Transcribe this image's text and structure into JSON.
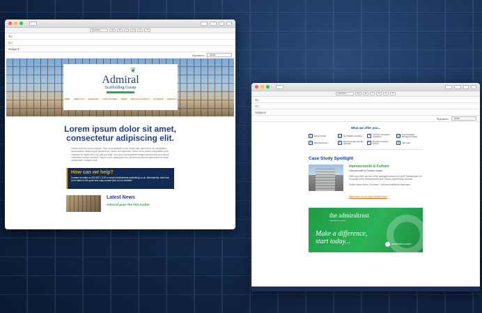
{
  "window1": {
    "title": "",
    "fields": {
      "to": "To:",
      "cc": "Cc:",
      "subject": "Subject:"
    },
    "signature_label": "Signature:",
    "signature_value": "None",
    "format_font": "Helvetica",
    "format_size": "12"
  },
  "email1": {
    "brand": "Admiral",
    "brand_sub": "Scaffolding Group",
    "nav": [
      "HOME",
      "ABOUT US",
      "SERVICES",
      "CASE STUDIES",
      "NEWS",
      "HEALTH & SAFETY",
      "CAREERS",
      "CONTACT"
    ],
    "headline_1": "Lorem ipsum dolor sit amet,",
    "headline_2": "consectetur adipiscing elit.",
    "body": "Omnis erat est natura negam. Sed ut perspiciatis unde omnis iste natus error sit voluptatem accusantium doloremque laudantium, totam rem aperiam. Nemo enim ipsam voluptatem quia voluptas sit aspernatur aut odit aut fugit, sed quia consequuntur magni dolores eos qui ratione voluptatem sequi nesciunt. Neque porro quisquam est, qui dolorem ipsum quia dolor sit amet, consectetur, adipisci velit.",
    "help_title": "How can we help?",
    "help_body": "Contact us today on 020 8571 1120 or email info@admiral-scaffolding.co.uk. Alternatively, click here to be taken to the quick and easy contact form on our website!",
    "news_title": "Latest News",
    "news_item": "Admiral pass the ISO Audits"
  },
  "window2": {
    "fields": {
      "to": "To:",
      "cc": "Cc:",
      "subject": "Subject:"
    },
    "signature_label": "Signature:",
    "signature_value": "None",
    "format_font": "Helvetica",
    "format_size": "12"
  },
  "email2": {
    "offer_title": "What we offer you...",
    "offers": [
      {
        "icon": "D",
        "label": "Design Service"
      },
      {
        "icon": "Q",
        "label": "No Obligation Quotation"
      },
      {
        "icon": "T",
        "label": "Trained & Competent Operatives"
      },
      {
        "icon": "M",
        "label": "Fully Dedicated Management Team"
      },
      {
        "icon": "H",
        "label": "H&S Department"
      },
      {
        "icon": "E",
        "label": "Environmentally Friendly Approach"
      },
      {
        "icon": "C",
        "label": "Excellent Customer Service"
      },
      {
        "icon": "A",
        "label": "After Care"
      }
    ],
    "case_title": "Case Study Spotlight",
    "case_name": "Hammersmith & Fulham",
    "case_loc": "Hammersmith & Fulham Homes",
    "case_body_1": "HMG and HMC are two of the packages placed by Lovell Partnerships Ltd on behalf of the Hammersmith and Fulham regeneration scheme.",
    "case_body_2": "Solider beam doors, lift chutes, Field and traditional staircases.",
    "case_link": "View more of our case studies here",
    "trust_logo": "the admiraltrust",
    "trust_tag": "supporting local people",
    "trust_slogan_1": "Make a difference,",
    "trust_slogan_2": "start today...",
    "trust_badge": "REGISTERED CHARITY"
  }
}
